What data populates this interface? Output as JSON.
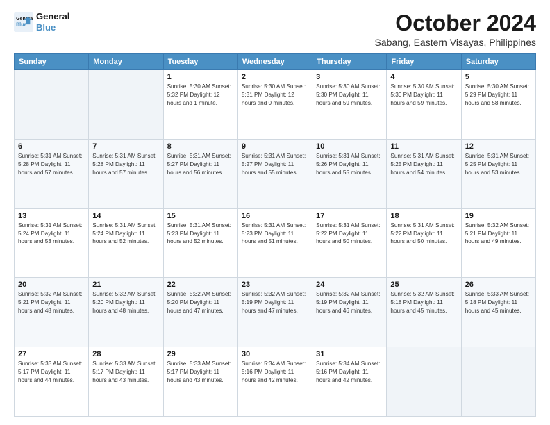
{
  "logo": {
    "line1": "General",
    "line2": "Blue"
  },
  "title": "October 2024",
  "subtitle": "Sabang, Eastern Visayas, Philippines",
  "days_header": [
    "Sunday",
    "Monday",
    "Tuesday",
    "Wednesday",
    "Thursday",
    "Friday",
    "Saturday"
  ],
  "weeks": [
    [
      {
        "day": "",
        "info": ""
      },
      {
        "day": "",
        "info": ""
      },
      {
        "day": "1",
        "info": "Sunrise: 5:30 AM\nSunset: 5:32 PM\nDaylight: 12 hours\nand 1 minute."
      },
      {
        "day": "2",
        "info": "Sunrise: 5:30 AM\nSunset: 5:31 PM\nDaylight: 12 hours\nand 0 minutes."
      },
      {
        "day": "3",
        "info": "Sunrise: 5:30 AM\nSunset: 5:30 PM\nDaylight: 11 hours\nand 59 minutes."
      },
      {
        "day": "4",
        "info": "Sunrise: 5:30 AM\nSunset: 5:30 PM\nDaylight: 11 hours\nand 59 minutes."
      },
      {
        "day": "5",
        "info": "Sunrise: 5:30 AM\nSunset: 5:29 PM\nDaylight: 11 hours\nand 58 minutes."
      }
    ],
    [
      {
        "day": "6",
        "info": "Sunrise: 5:31 AM\nSunset: 5:28 PM\nDaylight: 11 hours\nand 57 minutes."
      },
      {
        "day": "7",
        "info": "Sunrise: 5:31 AM\nSunset: 5:28 PM\nDaylight: 11 hours\nand 57 minutes."
      },
      {
        "day": "8",
        "info": "Sunrise: 5:31 AM\nSunset: 5:27 PM\nDaylight: 11 hours\nand 56 minutes."
      },
      {
        "day": "9",
        "info": "Sunrise: 5:31 AM\nSunset: 5:27 PM\nDaylight: 11 hours\nand 55 minutes."
      },
      {
        "day": "10",
        "info": "Sunrise: 5:31 AM\nSunset: 5:26 PM\nDaylight: 11 hours\nand 55 minutes."
      },
      {
        "day": "11",
        "info": "Sunrise: 5:31 AM\nSunset: 5:25 PM\nDaylight: 11 hours\nand 54 minutes."
      },
      {
        "day": "12",
        "info": "Sunrise: 5:31 AM\nSunset: 5:25 PM\nDaylight: 11 hours\nand 53 minutes."
      }
    ],
    [
      {
        "day": "13",
        "info": "Sunrise: 5:31 AM\nSunset: 5:24 PM\nDaylight: 11 hours\nand 53 minutes."
      },
      {
        "day": "14",
        "info": "Sunrise: 5:31 AM\nSunset: 5:24 PM\nDaylight: 11 hours\nand 52 minutes."
      },
      {
        "day": "15",
        "info": "Sunrise: 5:31 AM\nSunset: 5:23 PM\nDaylight: 11 hours\nand 52 minutes."
      },
      {
        "day": "16",
        "info": "Sunrise: 5:31 AM\nSunset: 5:23 PM\nDaylight: 11 hours\nand 51 minutes."
      },
      {
        "day": "17",
        "info": "Sunrise: 5:31 AM\nSunset: 5:22 PM\nDaylight: 11 hours\nand 50 minutes."
      },
      {
        "day": "18",
        "info": "Sunrise: 5:31 AM\nSunset: 5:22 PM\nDaylight: 11 hours\nand 50 minutes."
      },
      {
        "day": "19",
        "info": "Sunrise: 5:32 AM\nSunset: 5:21 PM\nDaylight: 11 hours\nand 49 minutes."
      }
    ],
    [
      {
        "day": "20",
        "info": "Sunrise: 5:32 AM\nSunset: 5:21 PM\nDaylight: 11 hours\nand 48 minutes."
      },
      {
        "day": "21",
        "info": "Sunrise: 5:32 AM\nSunset: 5:20 PM\nDaylight: 11 hours\nand 48 minutes."
      },
      {
        "day": "22",
        "info": "Sunrise: 5:32 AM\nSunset: 5:20 PM\nDaylight: 11 hours\nand 47 minutes."
      },
      {
        "day": "23",
        "info": "Sunrise: 5:32 AM\nSunset: 5:19 PM\nDaylight: 11 hours\nand 47 minutes."
      },
      {
        "day": "24",
        "info": "Sunrise: 5:32 AM\nSunset: 5:19 PM\nDaylight: 11 hours\nand 46 minutes."
      },
      {
        "day": "25",
        "info": "Sunrise: 5:32 AM\nSunset: 5:18 PM\nDaylight: 11 hours\nand 45 minutes."
      },
      {
        "day": "26",
        "info": "Sunrise: 5:33 AM\nSunset: 5:18 PM\nDaylight: 11 hours\nand 45 minutes."
      }
    ],
    [
      {
        "day": "27",
        "info": "Sunrise: 5:33 AM\nSunset: 5:17 PM\nDaylight: 11 hours\nand 44 minutes."
      },
      {
        "day": "28",
        "info": "Sunrise: 5:33 AM\nSunset: 5:17 PM\nDaylight: 11 hours\nand 43 minutes."
      },
      {
        "day": "29",
        "info": "Sunrise: 5:33 AM\nSunset: 5:17 PM\nDaylight: 11 hours\nand 43 minutes."
      },
      {
        "day": "30",
        "info": "Sunrise: 5:34 AM\nSunset: 5:16 PM\nDaylight: 11 hours\nand 42 minutes."
      },
      {
        "day": "31",
        "info": "Sunrise: 5:34 AM\nSunset: 5:16 PM\nDaylight: 11 hours\nand 42 minutes."
      },
      {
        "day": "",
        "info": ""
      },
      {
        "day": "",
        "info": ""
      }
    ]
  ]
}
